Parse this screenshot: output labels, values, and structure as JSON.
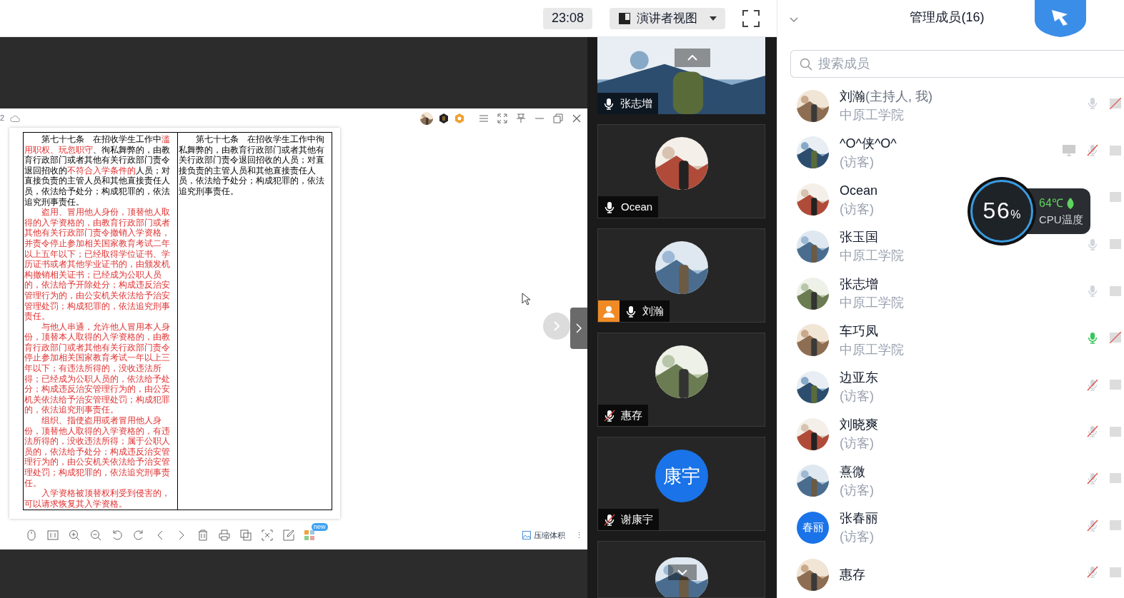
{
  "top_bar": {
    "timer": "23:08",
    "view_button": "演讲者视图"
  },
  "viewer": {
    "page_label": "2",
    "left_column": [
      {
        "segments": [
          {
            "text": "第七十七条　在招收学生工作中",
            "red": false
          },
          {
            "text": "滥用职权、玩忽职守",
            "red": true
          },
          {
            "text": "、徇私舞弊的，由教育行政部门或者其他有关行政部门责令退回招收的",
            "red": false
          },
          {
            "text": "不符合入学条件的",
            "red": true
          },
          {
            "text": "人员；对直接负责的主管人员和其他直接责任人员，依法给予处分；构成犯罪的，依法追究刑事责任。",
            "red": false
          }
        ]
      },
      {
        "segments": [
          {
            "text": "盗用、冒用他人身份，顶替他人取得的入学资格的，由教育行政部门或者其他有关行政部门责令撤销入学资格，并责令停止参加相关国家教育考试二年以上五年以下；已经取得学位证书、学历证书或者其他学业证书的，由颁发机构撤销相关证书；已经成为公职人员的，依法给予开除处分；构成违反治安管理行为的，由公安机关依法给予治安管理处罚；构成犯罪的，依法追究刑事责任。",
            "red": true
          }
        ]
      },
      {
        "segments": [
          {
            "text": "与他人串通，允许他人冒用本人身份，顶替本人取得的入学资格的，由教育行政部门或者其他有关行政部门责令停止参加相关国家教育考试一年以上三年以下；有违法所得的，没收违法所得；已经成为公职人员的，依法给予处分；构成违反治安管理行为的，由公安机关依法给予治安管理处罚；构成犯罪的，依法追究刑事责任。",
            "red": true
          }
        ]
      },
      {
        "segments": [
          {
            "text": "组织、指使盗用或者冒用他人身份，顶替他人取得的入学资格的，有违法所得的，没收违法所得；属于公职人员的，依法给予处分；构成违反治安管理行为的，由公安机关依法给予治安管理处罚；构成犯罪的，依法追究刑事责任。",
            "red": true
          }
        ]
      },
      {
        "segments": [
          {
            "text": "入学资格被顶替权利受到侵害的，可以请求恢复其入学资格。",
            "red": true
          }
        ]
      }
    ],
    "right_column": [
      {
        "segments": [
          {
            "text": "第七十七条　在招收学生工作中徇私舞弊的，由教育行政部门或者其他有关行政部门责令退回招收的人员；对直接负责的主管人员和其他直接责任人员，依法给予处分；构成犯罪的，依法追究刑事责任。",
            "red": false
          }
        ]
      }
    ],
    "new_badge": "new",
    "compress_button": "压缩体积",
    "more": "⋮"
  },
  "video_tiles": [
    {
      "name": "张志增",
      "muted": false
    },
    {
      "kind": "avatar",
      "name": "Ocean",
      "muted": false
    },
    {
      "kind": "avatar",
      "name": "刘瀚",
      "muted": false,
      "host": true
    },
    {
      "kind": "avatar",
      "name": "惠存",
      "muted": true
    },
    {
      "kind": "initials",
      "initials": "康宇",
      "name": "谢康宇",
      "muted": true
    },
    {
      "kind": "partial"
    }
  ],
  "members_panel": {
    "title": "管理成员(16)",
    "search": {
      "placeholder": "搜索成员"
    },
    "members": [
      {
        "name": "刘瀚",
        "note": "(主持人, 我)",
        "subtitle": "中原工学院",
        "muted": false,
        "speaking": false,
        "camera_blocked": true
      },
      {
        "name": "^O^侠^O^",
        "subtitle": "(访客)",
        "sharing": true,
        "muted": true,
        "camera_blocked": false
      },
      {
        "name": "Ocean",
        "subtitle": "(访客)",
        "camera_blocked": false
      },
      {
        "name": "张玉国",
        "subtitle": "中原工学院",
        "muted": false,
        "speaking": false,
        "camera_blocked": false
      },
      {
        "name": "张志增",
        "subtitle": "中原工学院",
        "muted": false,
        "speaking": false,
        "camera_blocked": false
      },
      {
        "name": "车巧凤",
        "subtitle": "中原工学院",
        "muted": false,
        "speaking": true,
        "camera_blocked": true
      },
      {
        "name": "边亚东",
        "subtitle": "(访客)",
        "muted": true,
        "camera_blocked": false
      },
      {
        "name": "刘晓爽",
        "subtitle": "(访客)",
        "muted": true,
        "camera_blocked": false
      },
      {
        "name": "熹微",
        "subtitle": "(访客)",
        "muted": true,
        "camera_blocked": false
      },
      {
        "kind": "initials",
        "initials": "春丽",
        "name": "张春丽",
        "subtitle": "(访客)",
        "muted": true,
        "camera_blocked": false
      },
      {
        "name": "惠存",
        "muted": true,
        "camera_blocked": false
      }
    ]
  },
  "cpu_widget": {
    "percent": "56",
    "unit": "%",
    "temperature": "64℃",
    "label": "CPU温度"
  }
}
